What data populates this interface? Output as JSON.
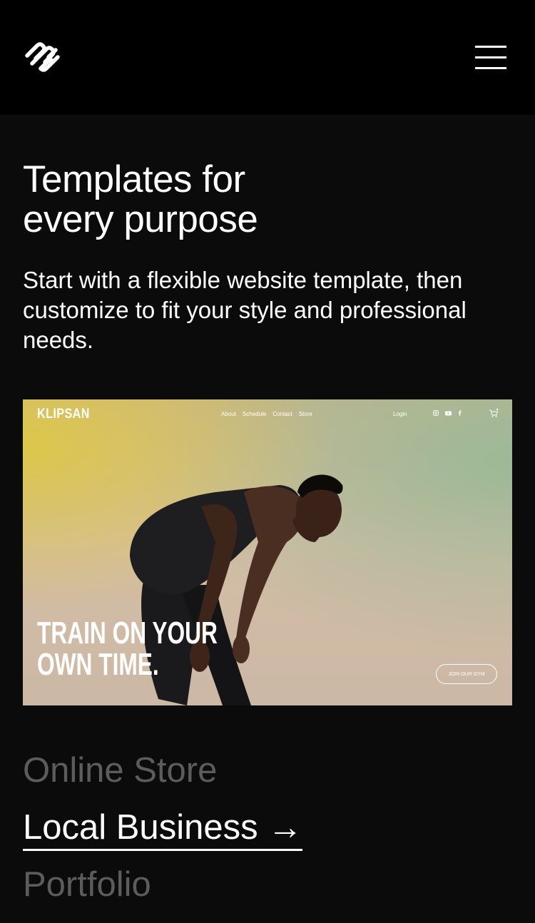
{
  "header": {
    "logo_icon": "squarespace-logo-icon",
    "menu_icon": "hamburger-menu-icon"
  },
  "hero": {
    "title_line1": "Templates for",
    "title_line2": "every purpose",
    "subtitle": "Start with a flexible website template, then customize to fit your style and professional needs."
  },
  "preview": {
    "brand": "KLIPSAN",
    "nav": [
      "About",
      "Schedule",
      "Contact",
      "Store"
    ],
    "login": "Login",
    "social": [
      "instagram-icon",
      "youtube-icon",
      "facebook-icon"
    ],
    "cart_icon": "cart-icon",
    "hero_line1": "TRAIN ON YOUR",
    "hero_line2": "OWN TIME.",
    "cta": "JOIN OUR GYM"
  },
  "categories": {
    "items": [
      {
        "label": "Online Store",
        "active": false
      },
      {
        "label": "Local Business →",
        "active": true
      },
      {
        "label": "Portfolio",
        "active": false
      }
    ]
  },
  "colors": {
    "background": "#0b0b0b",
    "header": "#000000",
    "text": "#ffffff",
    "inactive_text": "#5c5c5c"
  }
}
